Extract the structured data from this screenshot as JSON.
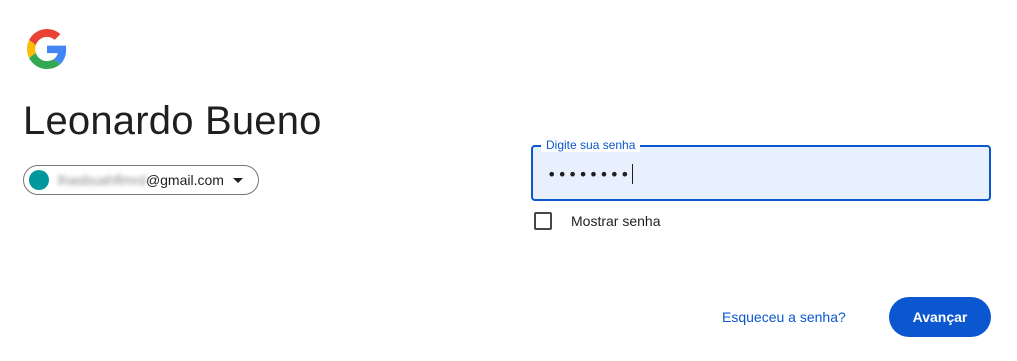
{
  "header": {
    "logo_icon": "google-logo-icon",
    "title": "Leonardo Bueno"
  },
  "account": {
    "email_local_redacted": "lhasbuahflmrd",
    "email_domain": "@gmail.com",
    "avatar_color": "#00979d",
    "dropdown_icon": "caret-down-icon"
  },
  "password": {
    "label": "Digite sua senha",
    "masked_value": "••••••••"
  },
  "show_password": {
    "label": "Mostrar senha",
    "checked": false
  },
  "actions": {
    "forgot_label": "Esqueceu a senha?",
    "next_label": "Avançar"
  },
  "colors": {
    "accent": "#0b57d0",
    "field_bg": "#e8f0fe"
  }
}
